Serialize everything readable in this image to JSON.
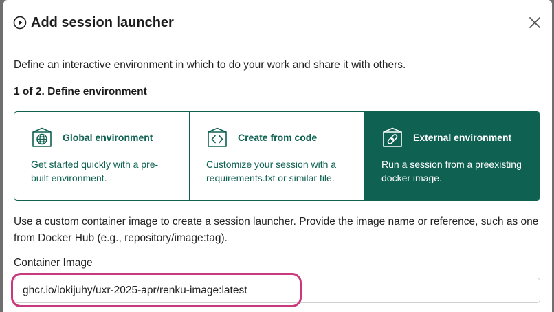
{
  "dialog": {
    "title": "Add session launcher",
    "intro": "Define an interactive environment in which to do your work and share it with others.",
    "step_title": "1 of 2. Define environment",
    "options": [
      {
        "title": "Global environment",
        "description": "Get started quickly with a pre-built environment.",
        "icon": "globe-box-icon",
        "selected": false
      },
      {
        "title": "Create from code",
        "description": "Customize your session with a requirements.txt or similar file.",
        "icon": "code-box-icon",
        "selected": false
      },
      {
        "title": "External environment",
        "description": "Run a session from a preexisting docker image.",
        "icon": "link-box-icon",
        "selected": true
      }
    ],
    "custom_image_text": "Use a custom container image to create a session launcher. Provide the image name or reference, such as one from Docker Hub (e.g., repository/image:tag).",
    "container_image_label": "Container Image",
    "container_image_value": "ghcr.io/lokijuhy/uxr-2025-apr/renku-image:latest"
  },
  "colors": {
    "accent": "#0f6152",
    "highlight": "#c93a7c"
  }
}
